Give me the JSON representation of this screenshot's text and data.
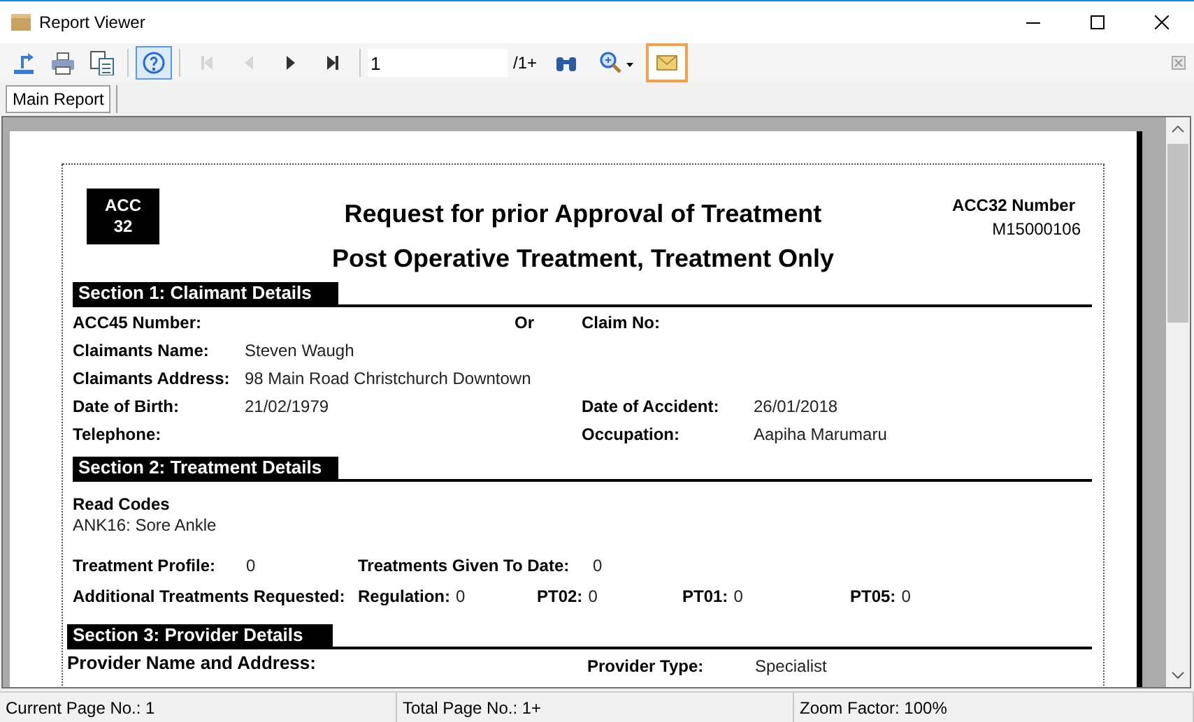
{
  "window": {
    "title": "Report Viewer"
  },
  "toolbar": {
    "buttons": [
      {
        "kind": "export",
        "disabled": false,
        "pressed": false,
        "highlighted": false
      },
      {
        "kind": "print",
        "disabled": false,
        "pressed": false,
        "highlighted": false
      },
      {
        "kind": "copy",
        "disabled": false,
        "pressed": false,
        "highlighted": false
      },
      {
        "kind": "help",
        "disabled": false,
        "pressed": true,
        "highlighted": false
      },
      {
        "kind": "first",
        "disabled": true,
        "pressed": false,
        "highlighted": false
      },
      {
        "kind": "previous",
        "disabled": true,
        "pressed": false,
        "highlighted": false
      },
      {
        "kind": "next",
        "disabled": false,
        "pressed": false,
        "highlighted": false
      },
      {
        "kind": "last",
        "disabled": false,
        "pressed": false,
        "highlighted": false
      }
    ],
    "page_field": {
      "value": "1"
    },
    "page_total": "/1+",
    "tools": [
      {
        "kind": "find",
        "highlighted": false
      },
      {
        "kind": "zoom",
        "highlighted": false
      },
      {
        "kind": "mail",
        "highlighted": true
      }
    ]
  },
  "tabs": [
    {
      "label": "Main Report",
      "selected": true
    }
  ],
  "report": {
    "badge": [
      "ACC",
      "32"
    ],
    "title": "Request for prior Approval of Treatment",
    "subtitle": "Post Operative Treatment, Treatment Only",
    "number_label": "ACC32 Number",
    "number_value": "M15000106",
    "section_1": {
      "heading": "Section 1: Claimant Details",
      "rows": [
        {
          "left": {
            "label": "ACC45 Number:"
          },
          "middle": "Or",
          "right": {
            "label": "Claim No:"
          }
        },
        {
          "left": {
            "label": "Claimants Name:",
            "value": "Steven Waugh"
          }
        },
        {
          "left": {
            "label": "Claimants Address:",
            "value": "98 Main Road Christchurch Downtown"
          }
        },
        {
          "left": {
            "label": "Date of Birth:",
            "value": "21/02/1979"
          },
          "right": {
            "label": "Date of Accident:",
            "value": "26/01/2018"
          }
        },
        {
          "left": {
            "label": "Telephone:"
          },
          "right": {
            "label": "Occupation:",
            "value": "Aapiha Marumaru"
          }
        }
      ]
    },
    "section_2": {
      "heading": "Section 2: Treatment Details",
      "read_codes_label": "Read Codes",
      "read_code": "ANK16: Sore Ankle",
      "profile": {
        "label": "Treatment Profile:",
        "value": "0"
      },
      "given": {
        "label": "Treatments Given To Date:",
        "value": "0"
      },
      "additional": {
        "label": "Additional Treatments Requested:",
        "items": [
          {
            "label": "Regulation:",
            "value": "0"
          },
          {
            "label": "PT02:",
            "value": "0"
          },
          {
            "label": "PT01:",
            "value": "0"
          },
          {
            "label": "PT05:",
            "value": "0"
          }
        ]
      }
    },
    "section_3": {
      "heading": "Section 3: Provider Details",
      "name_label": "Provider Name and Address:",
      "type_label": "Provider Type:",
      "type_value": "Specialist"
    }
  },
  "status_bar": [
    "Current Page No.: 1",
    "Total Page No.: 1+",
    "Zoom Factor: 100%"
  ]
}
